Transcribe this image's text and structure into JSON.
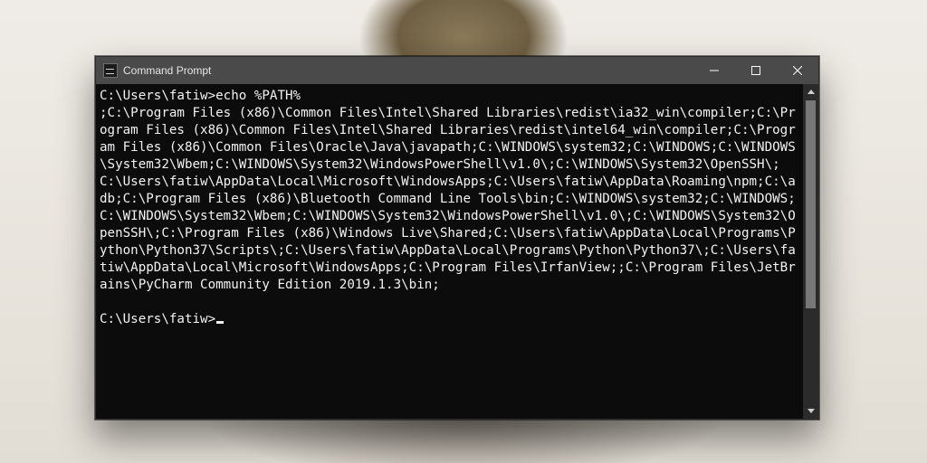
{
  "window": {
    "title": "Command Prompt"
  },
  "terminal": {
    "prompt1_prefix": "C:\\Users\\fatiw>",
    "command": "echo %PATH%",
    "output": ";C:\\Program Files (x86)\\Common Files\\Intel\\Shared Libraries\\redist\\ia32_win\\compiler;C:\\Program Files (x86)\\Common Files\\Intel\\Shared Libraries\\redist\\intel64_win\\compiler;C:\\Program Files (x86)\\Common Files\\Oracle\\Java\\javapath;C:\\WINDOWS\\system32;C:\\WINDOWS;C:\\WINDOWS\\System32\\Wbem;C:\\WINDOWS\\System32\\WindowsPowerShell\\v1.0\\;C:\\WINDOWS\\System32\\OpenSSH\\;C:\\Users\\fatiw\\AppData\\Local\\Microsoft\\WindowsApps;C:\\Users\\fatiw\\AppData\\Roaming\\npm;C:\\adb;C:\\Program Files (x86)\\Bluetooth Command Line Tools\\bin;C:\\WINDOWS\\system32;C:\\WINDOWS;C:\\WINDOWS\\System32\\Wbem;C:\\WINDOWS\\System32\\WindowsPowerShell\\v1.0\\;C:\\WINDOWS\\System32\\OpenSSH\\;C:\\Program Files (x86)\\Windows Live\\Shared;C:\\Users\\fatiw\\AppData\\Local\\Programs\\Python\\Python37\\Scripts\\;C:\\Users\\fatiw\\AppData\\Local\\Programs\\Python\\Python37\\;C:\\Users\\fatiw\\AppData\\Local\\Microsoft\\WindowsApps;C:\\Program Files\\IrfanView;;C:\\Program Files\\JetBrains\\PyCharm Community Edition 2019.1.3\\bin;",
    "prompt2_prefix": "C:\\Users\\fatiw>"
  }
}
